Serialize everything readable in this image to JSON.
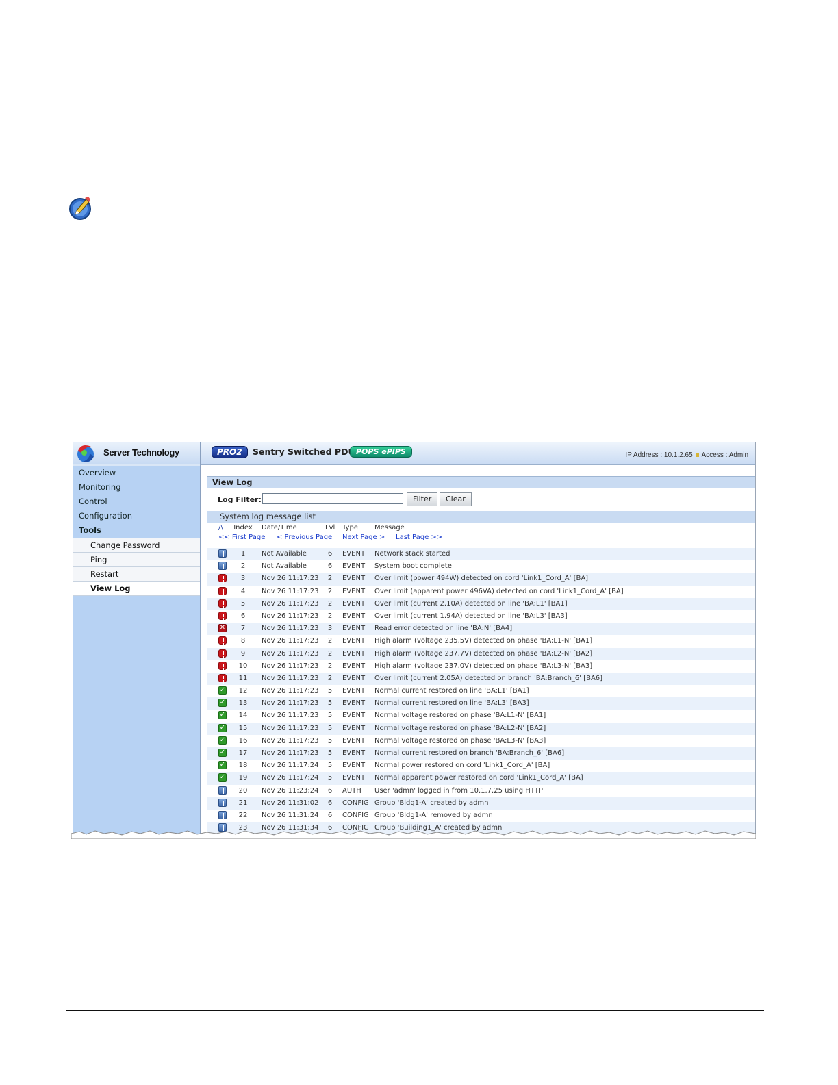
{
  "brand": {
    "name": "Server Technology"
  },
  "header": {
    "pro_badge": "PRO2",
    "product": "Sentry Switched PDU",
    "pops_badge": "POPS ePIPS",
    "ip_label": "IP Address : 10.1.2.65",
    "access_label": "Access : Admin"
  },
  "sidebar": {
    "items": [
      {
        "label": "Overview"
      },
      {
        "label": "Monitoring"
      },
      {
        "label": "Control"
      },
      {
        "label": "Configuration"
      },
      {
        "label": "Tools"
      }
    ],
    "tools_sub": [
      {
        "label": "Change Password"
      },
      {
        "label": "Ping"
      },
      {
        "label": "Restart"
      },
      {
        "label": "View Log"
      }
    ]
  },
  "page": {
    "title": "View Log",
    "filter_label": "Log Filter:",
    "filter_value": "",
    "filter_button": "Filter",
    "clear_button": "Clear",
    "list_title": "System log message list"
  },
  "table": {
    "sort_indicator": "/\\",
    "headers": {
      "index": "Index",
      "date": "Date/Time",
      "lvl": "Lvl",
      "type": "Type",
      "message": "Message"
    },
    "pager": {
      "first": "<< First Page",
      "previous": "< Previous Page",
      "next": "Next Page >",
      "last": "Last Page >>"
    },
    "rows": [
      {
        "icon": "info",
        "index": "1",
        "date": "Not Available",
        "lvl": "6",
        "type": "EVENT",
        "message": "Network stack started"
      },
      {
        "icon": "info",
        "index": "2",
        "date": "Not Available",
        "lvl": "6",
        "type": "EVENT",
        "message": "System boot complete"
      },
      {
        "icon": "alarm",
        "index": "3",
        "date": "Nov 26 11:17:23",
        "lvl": "2",
        "type": "EVENT",
        "message": "Over limit (power 494W) detected on cord 'Link1_Cord_A' [BA]"
      },
      {
        "icon": "alarm",
        "index": "4",
        "date": "Nov 26 11:17:23",
        "lvl": "2",
        "type": "EVENT",
        "message": "Over limit (apparent power 496VA) detected on cord 'Link1_Cord_A' [BA]"
      },
      {
        "icon": "alarm",
        "index": "5",
        "date": "Nov 26 11:17:23",
        "lvl": "2",
        "type": "EVENT",
        "message": "Over limit (current 2.10A) detected on line 'BA:L1' [BA1]"
      },
      {
        "icon": "alarm",
        "index": "6",
        "date": "Nov 26 11:17:23",
        "lvl": "2",
        "type": "EVENT",
        "message": "Over limit (current 1.94A) detected on line 'BA:L3' [BA3]"
      },
      {
        "icon": "error",
        "index": "7",
        "date": "Nov 26 11:17:23",
        "lvl": "3",
        "type": "EVENT",
        "message": "Read error detected on line 'BA:N' [BA4]"
      },
      {
        "icon": "alarm",
        "index": "8",
        "date": "Nov 26 11:17:23",
        "lvl": "2",
        "type": "EVENT",
        "message": "High alarm (voltage 235.5V) detected on phase 'BA:L1-N' [BA1]"
      },
      {
        "icon": "alarm",
        "index": "9",
        "date": "Nov 26 11:17:23",
        "lvl": "2",
        "type": "EVENT",
        "message": "High alarm (voltage 237.7V) detected on phase 'BA:L2-N' [BA2]"
      },
      {
        "icon": "alarm",
        "index": "10",
        "date": "Nov 26 11:17:23",
        "lvl": "2",
        "type": "EVENT",
        "message": "High alarm (voltage 237.0V) detected on phase 'BA:L3-N' [BA3]"
      },
      {
        "icon": "alarm",
        "index": "11",
        "date": "Nov 26 11:17:23",
        "lvl": "2",
        "type": "EVENT",
        "message": "Over limit (current 2.05A) detected on branch 'BA:Branch_6' [BA6]"
      },
      {
        "icon": "ok",
        "index": "12",
        "date": "Nov 26 11:17:23",
        "lvl": "5",
        "type": "EVENT",
        "message": "Normal current restored on line 'BA:L1' [BA1]"
      },
      {
        "icon": "ok",
        "index": "13",
        "date": "Nov 26 11:17:23",
        "lvl": "5",
        "type": "EVENT",
        "message": "Normal current restored on line 'BA:L3' [BA3]"
      },
      {
        "icon": "ok",
        "index": "14",
        "date": "Nov 26 11:17:23",
        "lvl": "5",
        "type": "EVENT",
        "message": "Normal voltage restored on phase 'BA:L1-N' [BA1]"
      },
      {
        "icon": "ok",
        "index": "15",
        "date": "Nov 26 11:17:23",
        "lvl": "5",
        "type": "EVENT",
        "message": "Normal voltage restored on phase 'BA:L2-N' [BA2]"
      },
      {
        "icon": "ok",
        "index": "16",
        "date": "Nov 26 11:17:23",
        "lvl": "5",
        "type": "EVENT",
        "message": "Normal voltage restored on phase 'BA:L3-N' [BA3]"
      },
      {
        "icon": "ok",
        "index": "17",
        "date": "Nov 26 11:17:23",
        "lvl": "5",
        "type": "EVENT",
        "message": "Normal current restored on branch 'BA:Branch_6' [BA6]"
      },
      {
        "icon": "ok",
        "index": "18",
        "date": "Nov 26 11:17:24",
        "lvl": "5",
        "type": "EVENT",
        "message": "Normal power restored on cord 'Link1_Cord_A' [BA]"
      },
      {
        "icon": "ok",
        "index": "19",
        "date": "Nov 26 11:17:24",
        "lvl": "5",
        "type": "EVENT",
        "message": "Normal apparent power restored on cord 'Link1_Cord_A' [BA]"
      },
      {
        "icon": "info",
        "index": "20",
        "date": "Nov 26 11:23:24",
        "lvl": "6",
        "type": "AUTH",
        "message": "User 'admn' logged in from 10.1.7.25 using HTTP"
      },
      {
        "icon": "info",
        "index": "21",
        "date": "Nov 26 11:31:02",
        "lvl": "6",
        "type": "CONFIG",
        "message": "Group 'Bldg1-A' created by admn"
      },
      {
        "icon": "info",
        "index": "22",
        "date": "Nov 26 11:31:24",
        "lvl": "6",
        "type": "CONFIG",
        "message": "Group 'Bldg1-A' removed by admn"
      },
      {
        "icon": "info",
        "index": "23",
        "date": "Nov 26 11:31:34",
        "lvl": "6",
        "type": "CONFIG",
        "message": "Group 'Building1_A' created by admn"
      }
    ]
  },
  "colors": {
    "sidebar_bg": "#b7d2f3",
    "header_bg": "#c9dbf3",
    "alt_row": "#e9f1fb",
    "link": "#1a3ccc"
  }
}
